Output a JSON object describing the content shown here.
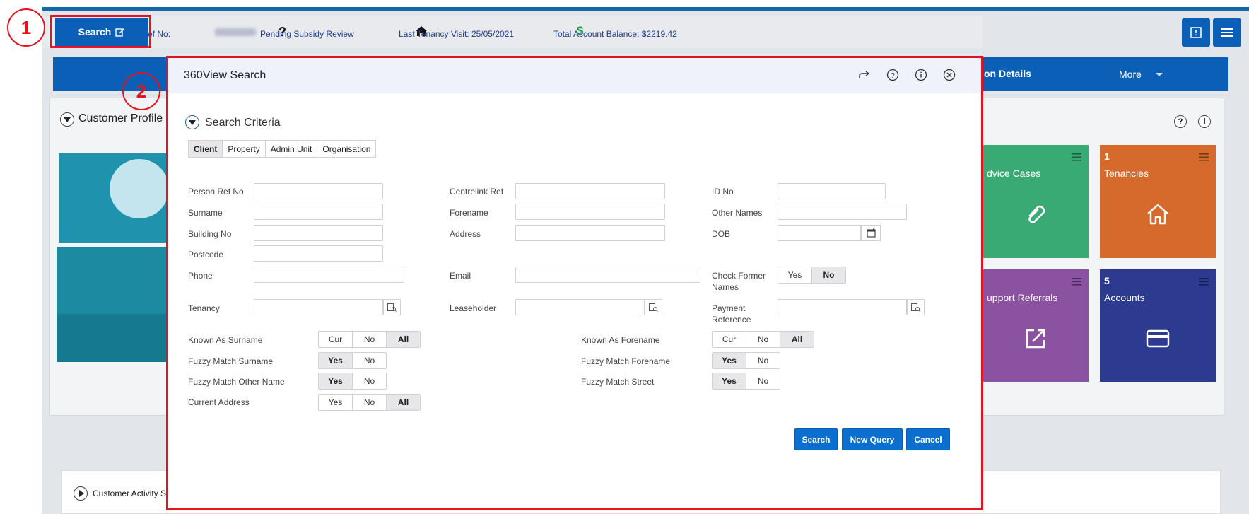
{
  "annotations": {
    "step1": "1",
    "step2": "2"
  },
  "topbar": {
    "search_label": "Search",
    "ref_label": "ef No:",
    "status": "Pending Subsidy Review",
    "last_visit": "Last Tenancy Visit: 25/05/2021",
    "balance": "Total Account Balance: $2219.42"
  },
  "nav": {
    "details": "on Details",
    "more": "More"
  },
  "profile": {
    "title": "Customer Profile f"
  },
  "tiles": [
    {
      "count": "",
      "label": "dvice Cases",
      "color": "#3aaa74",
      "icon": "paperclip-icon"
    },
    {
      "count": "1",
      "label": "Tenancies",
      "color": "#d66a2c",
      "icon": "home-icon"
    },
    {
      "count": "",
      "label": "upport Referrals",
      "color": "#8b52a2",
      "icon": "external-link-icon"
    },
    {
      "count": "5",
      "label": "Accounts",
      "color": "#2c3a8f",
      "icon": "credit-card-icon"
    }
  ],
  "activity": {
    "title": "Customer Activity Se"
  },
  "modal": {
    "title": "360View Search",
    "criteria_title": "Search Criteria",
    "tabs": [
      "Client",
      "Property",
      "Admin Unit",
      "Organisation"
    ],
    "fields": {
      "person_ref": "Person Ref No",
      "centrelink": "Centrelink Ref",
      "id_no": "ID No",
      "surname": "Surname",
      "forename": "Forename",
      "other_names": "Other Names",
      "building": "Building No",
      "address": "Address",
      "dob": "DOB",
      "postcode": "Postcode",
      "phone": "Phone",
      "email": "Email",
      "check_former": "Check Former Names",
      "tenancy": "Tenancy",
      "leaseholder": "Leaseholder",
      "payment_ref": "Payment Reference",
      "known_surname": "Known As Surname",
      "known_forename": "Known As Forename",
      "fuzzy_surname": "Fuzzy Match Surname",
      "fuzzy_forename": "Fuzzy Match Forename",
      "fuzzy_other": "Fuzzy Match Other Name",
      "fuzzy_street": "Fuzzy Match Street",
      "current_address": "Current Address"
    },
    "options": {
      "yes": "Yes",
      "no": "No",
      "cur": "Cur",
      "all": "All"
    },
    "buttons": {
      "search": "Search",
      "new_query": "New Query",
      "cancel": "Cancel"
    }
  }
}
